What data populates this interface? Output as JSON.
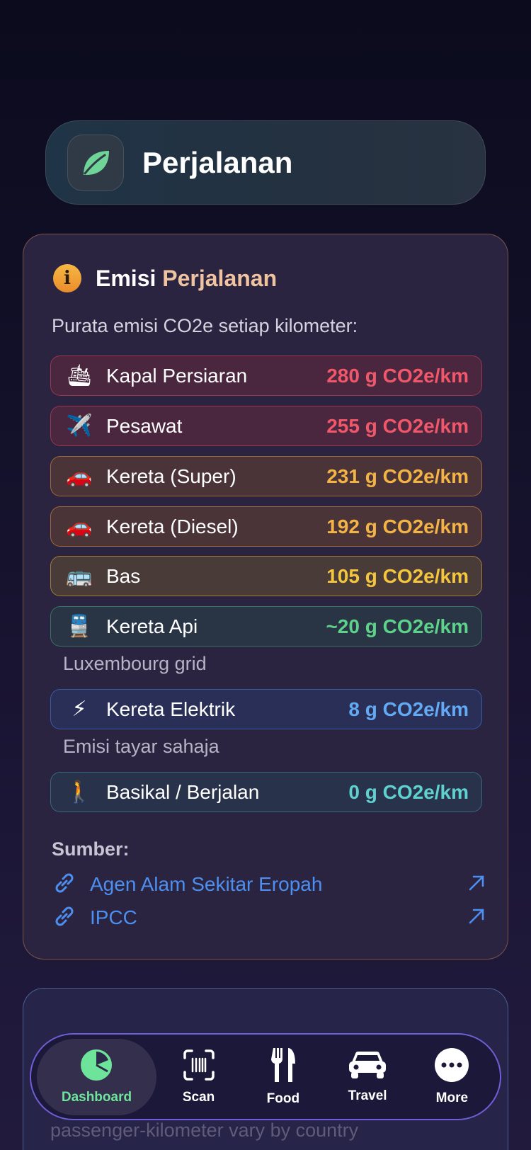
{
  "header": {
    "title": "Perjalanan",
    "icon": "leaf-icon"
  },
  "card": {
    "title_part1": "Emisi",
    "title_part2": "Perjalanan",
    "subtitle": "Purata emisi CO2e setiap kilometer:",
    "rows": [
      {
        "emoji": "🛳",
        "label": "Kapal Persiaran",
        "value": "280 g CO2e/km"
      },
      {
        "emoji": "✈️",
        "label": "Pesawat",
        "value": "255 g CO2e/km"
      },
      {
        "emoji": "🚗",
        "label": "Kereta (Super)",
        "value": "231 g CO2e/km"
      },
      {
        "emoji": "🚗",
        "label": "Kereta (Diesel)",
        "value": "192 g CO2e/km"
      },
      {
        "emoji": "🚌",
        "label": "Bas",
        "value": "105 g CO2e/km"
      },
      {
        "emoji": "🚆",
        "label": "Kereta Api",
        "value": "~20 g CO2e/km"
      },
      {
        "emoji": "⚡",
        "label": "Kereta Elektrik",
        "value": "8 g CO2e/km"
      },
      {
        "emoji": "🚶",
        "label": "Basikal / Berjalan",
        "value": "0 g CO2e/km"
      }
    ],
    "notes": [
      "Luxembourg grid",
      "Emisi tayar sahaja"
    ],
    "sources_title": "Sumber:",
    "sources": [
      {
        "label": "Agen Alam Sekitar Eropah"
      },
      {
        "label": "IPCC"
      }
    ]
  },
  "card2": {
    "text": "passenger-kilometer vary by country"
  },
  "tabbar": {
    "tabs": [
      {
        "label": "Dashboard",
        "icon": "pie-chart-icon",
        "active": true
      },
      {
        "label": "Scan",
        "icon": "barcode-scan-icon"
      },
      {
        "label": "Food",
        "icon": "fork-knife-icon"
      },
      {
        "label": "Travel",
        "icon": "car-icon"
      },
      {
        "label": "More",
        "icon": "more-icon"
      }
    ]
  },
  "colors": {
    "accent_green": "#6ee39a",
    "link_blue": "#4d8ff0",
    "tabbar_border": "#6f5fd6"
  }
}
